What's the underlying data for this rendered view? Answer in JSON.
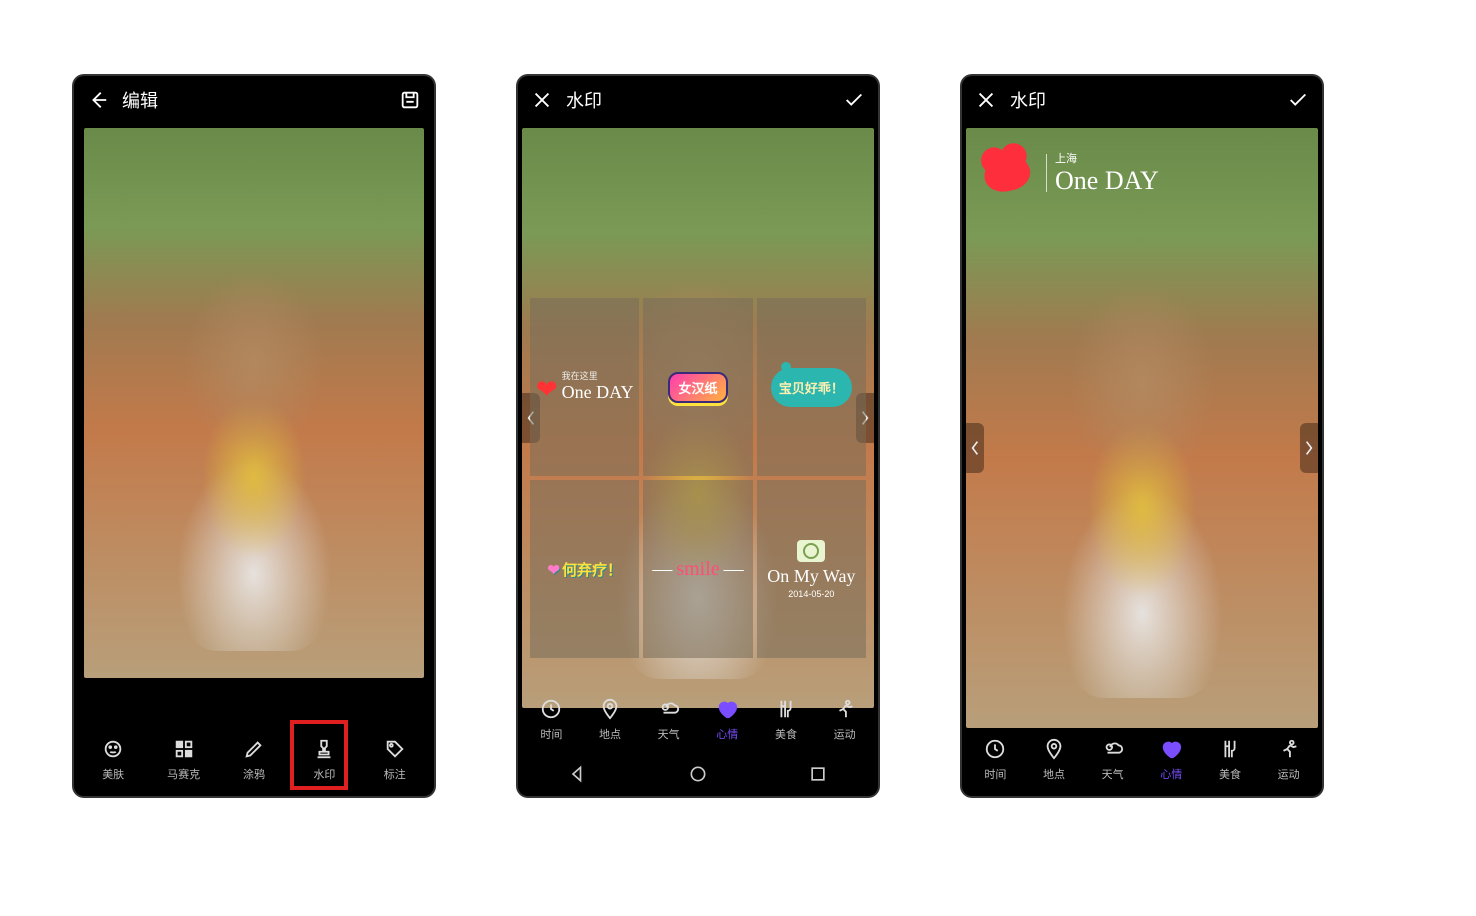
{
  "screen1": {
    "title": "编辑",
    "tools": [
      {
        "label": "美肤",
        "icon": "face"
      },
      {
        "label": "马赛克",
        "icon": "mosaic"
      },
      {
        "label": "涂鸦",
        "icon": "brush"
      },
      {
        "label": "水印",
        "icon": "stamp"
      },
      {
        "label": "标注",
        "icon": "tag"
      }
    ],
    "highlighted_tool_index": 3
  },
  "screen2": {
    "title": "水印",
    "categories": [
      {
        "label": "时间",
        "icon": "clock"
      },
      {
        "label": "地点",
        "icon": "pin"
      },
      {
        "label": "天气",
        "icon": "weather"
      },
      {
        "label": "心情",
        "icon": "heart",
        "active": true
      },
      {
        "label": "美食",
        "icon": "food"
      },
      {
        "label": "运动",
        "icon": "run"
      }
    ],
    "watermarks": [
      {
        "id": "oneday",
        "line1": "我在这里",
        "line2": "One DAY"
      },
      {
        "id": "nhz",
        "text": "女汉纸"
      },
      {
        "id": "bbhg",
        "text": "宝贝好乖！"
      },
      {
        "id": "hbl",
        "text": "何弃疗！"
      },
      {
        "id": "smile",
        "text": "smile"
      },
      {
        "id": "omw",
        "text": "On My Way",
        "date": "2014-05-20"
      }
    ]
  },
  "screen3": {
    "title": "水印",
    "categories": [
      {
        "label": "时间",
        "icon": "clock"
      },
      {
        "label": "地点",
        "icon": "pin"
      },
      {
        "label": "天气",
        "icon": "weather"
      },
      {
        "label": "心情",
        "icon": "heart",
        "active": true
      },
      {
        "label": "美食",
        "icon": "food"
      },
      {
        "label": "运动",
        "icon": "run"
      }
    ],
    "applied": {
      "location": "上海",
      "text": "One DAY"
    }
  }
}
